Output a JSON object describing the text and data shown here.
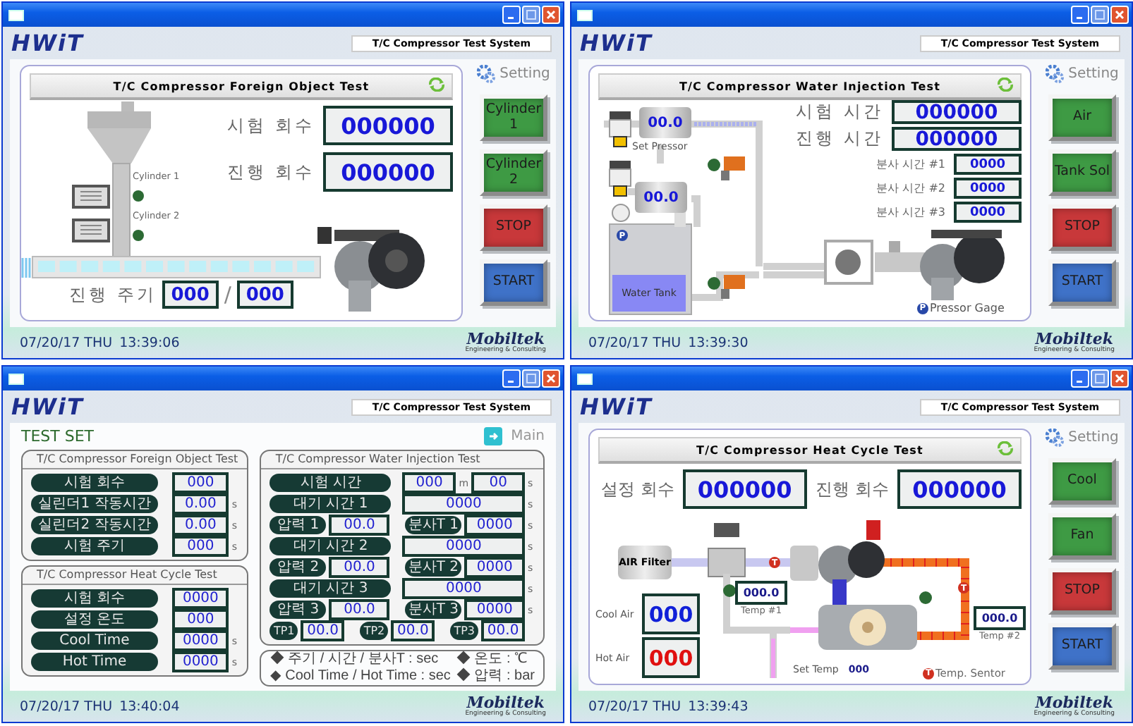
{
  "windows": [
    {
      "kind": "foreign_object",
      "logo": "HWiT",
      "system_title": "T/C Compressor Test System",
      "panel_title": "T/C Compressor Foreign Object Test",
      "setting": "Setting",
      "counters": [
        {
          "label": "시험 회수",
          "value": "000000"
        },
        {
          "label": "진행 회수",
          "value": "000000"
        }
      ],
      "cylinders": [
        {
          "label": "Cylinder 1"
        },
        {
          "label": "Cylinder 2"
        }
      ],
      "cycle": {
        "label": "진행 주기",
        "current": "000",
        "separator": "/",
        "total": "000"
      },
      "buttons": [
        {
          "label": "Cylinder 1",
          "color": "#3e9a44"
        },
        {
          "label": "Cylinder 2",
          "color": "#3e9a44"
        },
        {
          "label": "STOP",
          "color": "#c8383a"
        },
        {
          "label": "START",
          "color": "#3f72c8"
        }
      ],
      "date": "07/20/17 THU",
      "time": "13:39:06",
      "footer_logo": "Mobiltek",
      "footer_tagline": "Engineering & Consulting"
    },
    {
      "kind": "water_injection",
      "logo": "HWiT",
      "system_title": "T/C Compressor Test System",
      "panel_title": "T/C Compressor Water Injection Test",
      "setting": "Setting",
      "counters": [
        {
          "label": "시험 시간",
          "value": "000000"
        },
        {
          "label": "진행 시간",
          "value": "000000"
        }
      ],
      "injections": [
        {
          "label": "분사 시간 #1",
          "value": "0000"
        },
        {
          "label": "분사 시간 #2",
          "value": "0000"
        },
        {
          "label": "분사 시간 #3",
          "value": "0000"
        }
      ],
      "gauges": [
        {
          "value": "00.0",
          "label": "Set Pressor"
        },
        {
          "value": "00.0"
        }
      ],
      "tank": {
        "mark": "P",
        "label": "Water Tank"
      },
      "gage": {
        "mark": "P",
        "label": "Pressor Gage"
      },
      "buttons": [
        {
          "label": "Air",
          "color": "#3e9a44"
        },
        {
          "label": "Tank Sol",
          "color": "#3e9a44"
        },
        {
          "label": "STOP",
          "color": "#c8383a"
        },
        {
          "label": "START",
          "color": "#3f72c8"
        }
      ],
      "date": "07/20/17 THU",
      "time": "13:39:30",
      "footer_logo": "Mobiltek",
      "footer_tagline": "Engineering & Consulting"
    },
    {
      "kind": "test_set",
      "logo": "HWiT",
      "system_title": "T/C Compressor Test System",
      "title": "TEST SET",
      "main_link": "Main",
      "columns": [
        {
          "groups": [
            {
              "title": "T/C Compressor Foreign Object Test",
              "rows": [
                {
                  "kind": "wide",
                  "cells": [
                    {
                      "label": "시험 회수",
                      "values": [
                        {
                          "value": "000"
                        }
                      ]
                    }
                  ]
                },
                {
                  "kind": "wide",
                  "cells": [
                    {
                      "label": "실린더1 작동시간",
                      "values": [
                        {
                          "value": "0.00",
                          "unit": "s"
                        }
                      ]
                    }
                  ]
                },
                {
                  "kind": "wide",
                  "cells": [
                    {
                      "label": "실린더2 작동시간",
                      "values": [
                        {
                          "value": "0.00",
                          "unit": "s"
                        }
                      ]
                    }
                  ]
                },
                {
                  "kind": "wide",
                  "cells": [
                    {
                      "label": "시험 주기",
                      "values": [
                        {
                          "value": "000",
                          "unit": "s"
                        }
                      ]
                    }
                  ]
                }
              ]
            },
            {
              "title": "T/C Compressor Heat Cycle Test",
              "rows": [
                {
                  "kind": "wide",
                  "cells": [
                    {
                      "label": "시험 회수",
                      "values": [
                        {
                          "value": "0000"
                        }
                      ]
                    }
                  ]
                },
                {
                  "kind": "wide",
                  "cells": [
                    {
                      "label": "설정 온도",
                      "values": [
                        {
                          "value": "000"
                        }
                      ]
                    }
                  ]
                },
                {
                  "kind": "wide",
                  "cells": [
                    {
                      "label": "Cool Time",
                      "values": [
                        {
                          "value": "0000",
                          "unit": "s"
                        }
                      ]
                    }
                  ]
                },
                {
                  "kind": "wide",
                  "cells": [
                    {
                      "label": "Hot Time",
                      "values": [
                        {
                          "value": "0000",
                          "unit": "s"
                        }
                      ]
                    }
                  ]
                }
              ]
            }
          ]
        },
        {
          "groups": [
            {
              "title": "T/C Compressor Water Injection Test",
              "rows": [
                {
                  "kind": "wide",
                  "cells": [
                    {
                      "label": "시험 시간",
                      "values": [
                        {
                          "value": "000",
                          "unit": "m"
                        },
                        {
                          "value": "00",
                          "unit": "s"
                        }
                      ]
                    }
                  ]
                },
                {
                  "kind": "wide",
                  "cells": [
                    {
                      "label": "대기 시간 1",
                      "values": [
                        {
                          "value": "0000",
                          "unit": "s"
                        }
                      ]
                    }
                  ]
                },
                {
                  "kind": "pair",
                  "cells": [
                    {
                      "label": "압력 1",
                      "values": [
                        {
                          "value": "00.0"
                        }
                      ]
                    },
                    {
                      "label": "분사T 1",
                      "values": [
                        {
                          "value": "0000",
                          "unit": "s"
                        }
                      ]
                    }
                  ]
                },
                {
                  "kind": "wide",
                  "cells": [
                    {
                      "label": "대기 시간 2",
                      "values": [
                        {
                          "value": "0000",
                          "unit": "s"
                        }
                      ]
                    }
                  ]
                },
                {
                  "kind": "pair",
                  "cells": [
                    {
                      "label": "압력 2",
                      "values": [
                        {
                          "value": "00.0"
                        }
                      ]
                    },
                    {
                      "label": "분사T 2",
                      "values": [
                        {
                          "value": "0000",
                          "unit": "s"
                        }
                      ]
                    }
                  ]
                },
                {
                  "kind": "wide",
                  "cells": [
                    {
                      "label": "대기 시간 3",
                      "values": [
                        {
                          "value": "0000",
                          "unit": "s"
                        }
                      ]
                    }
                  ]
                },
                {
                  "kind": "pair",
                  "cells": [
                    {
                      "label": "압력 3",
                      "values": [
                        {
                          "value": "00.0"
                        }
                      ]
                    },
                    {
                      "label": "분사T 3",
                      "values": [
                        {
                          "value": "0000",
                          "unit": "s"
                        }
                      ]
                    }
                  ]
                },
                {
                  "kind": "triple",
                  "cells": [
                    {
                      "label": "TP1",
                      "values": [
                        {
                          "value": "00.0"
                        }
                      ]
                    },
                    {
                      "label": "TP2",
                      "values": [
                        {
                          "value": "00.0"
                        }
                      ]
                    },
                    {
                      "label": "TP3",
                      "values": [
                        {
                          "value": "00.0"
                        }
                      ]
                    }
                  ]
                }
              ]
            }
          ],
          "legend": [
            "◆ 주기 / 시간 / 분사T : sec",
            "◆ 온도 : ℃",
            "◆ Cool Time / Hot Time : sec",
            "◆ 압력 : bar"
          ]
        }
      ],
      "date": "07/20/17 THU",
      "time": "13:40:04",
      "footer_logo": "Mobiltek",
      "footer_tagline": "Engineering & Consulting"
    },
    {
      "kind": "heat_cycle",
      "logo": "HWiT",
      "system_title": "T/C Compressor Test System",
      "panel_title": "T/C Compressor Heat Cycle Test",
      "setting": "Setting",
      "counters": [
        {
          "label": "설정 회수",
          "value": "000000"
        },
        {
          "label": "진행 회수",
          "value": "000000"
        }
      ],
      "air_filter": "AIR Filter",
      "temps": [
        {
          "label": "Temp #1",
          "value": "000.0"
        },
        {
          "label": "Temp #2",
          "value": "000.0"
        }
      ],
      "air": [
        {
          "label": "Cool Air",
          "value": "000",
          "color": "#1020d8"
        },
        {
          "label": "Hot Air",
          "value": "000",
          "color": "#e01010"
        }
      ],
      "set_temp": {
        "label": "Set Temp",
        "value": "000"
      },
      "pipe_sensor_marks": [
        "T",
        "T"
      ],
      "sensor": {
        "mark": "T",
        "label": "Temp. Sentor"
      },
      "buttons": [
        {
          "label": "Cool",
          "color": "#3e9a44"
        },
        {
          "label": "Fan",
          "color": "#3e9a44"
        },
        {
          "label": "STOP",
          "color": "#c8383a"
        },
        {
          "label": "START",
          "color": "#3f72c8"
        }
      ],
      "date": "07/20/17 THU",
      "time": "13:39:43",
      "footer_logo": "Mobiltek",
      "footer_tagline": "Engineering & Consulting"
    }
  ]
}
